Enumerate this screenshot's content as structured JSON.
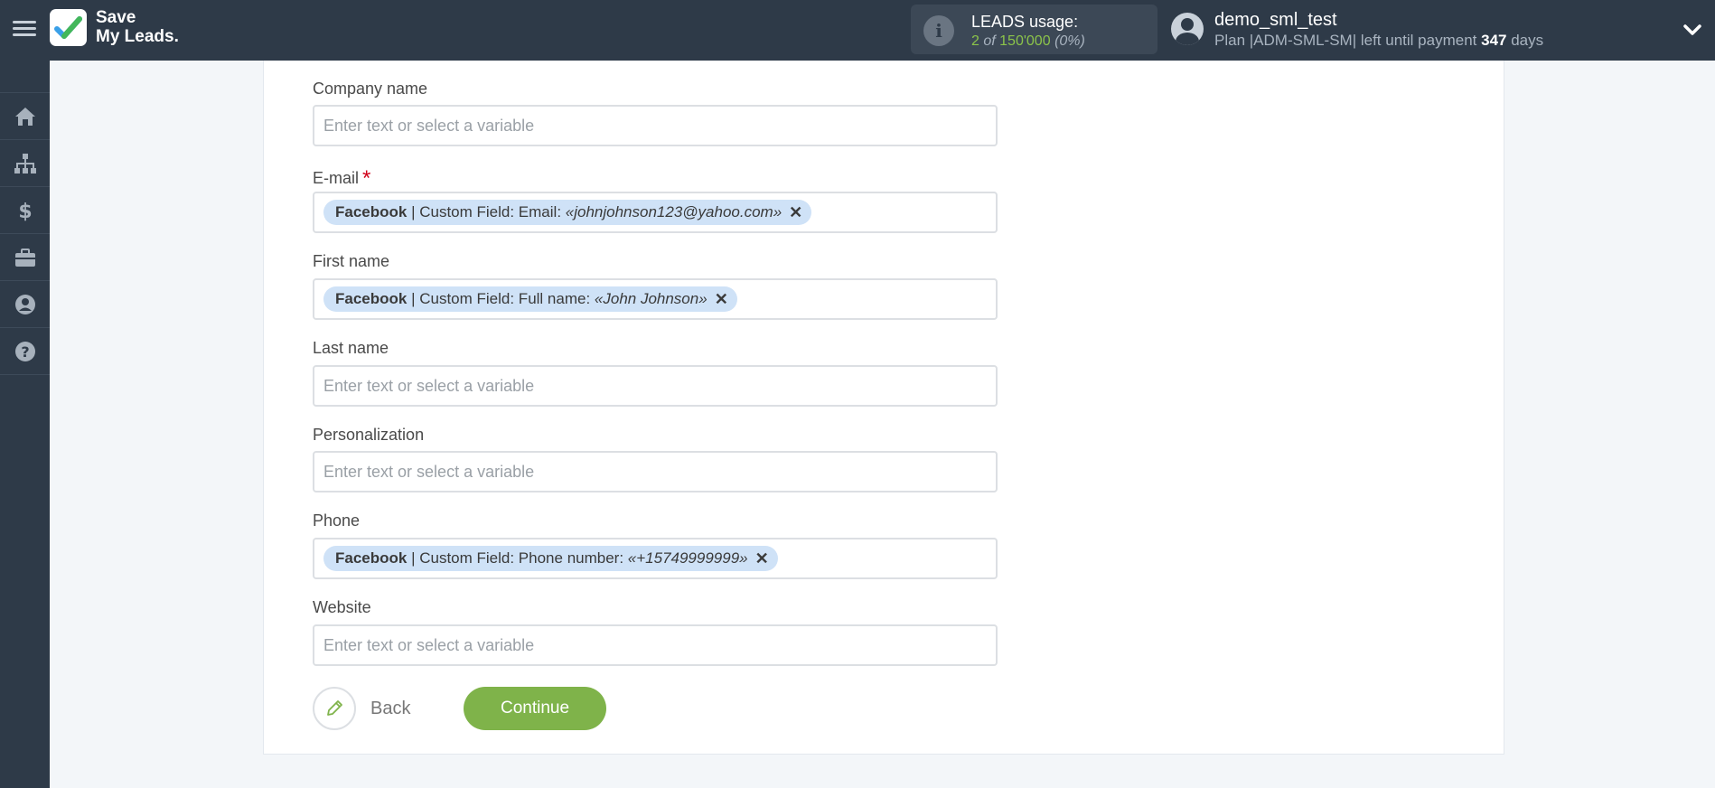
{
  "header": {
    "brand_line1": "Save",
    "brand_line2": "My Leads.",
    "usage_title": "LEADS usage:",
    "usage_used": "2",
    "usage_of": "of",
    "usage_total": "150'000",
    "usage_pct": "(0%)",
    "user_name": "demo_sml_test",
    "plan_prefix": "Plan |ADM-SML-SM| left until payment",
    "plan_days": "347",
    "plan_suffix": "days"
  },
  "colors": {
    "topbar": "#2e3a48",
    "accent_green": "#7fb34a",
    "chip_bg": "#cfe2f7",
    "required": "#d0021b"
  },
  "sidebar": {
    "items": [
      {
        "icon": "home-icon"
      },
      {
        "icon": "sitemap-icon"
      },
      {
        "icon": "dollar-icon"
      },
      {
        "icon": "briefcase-icon"
      },
      {
        "icon": "account-icon"
      },
      {
        "icon": "help-icon"
      }
    ]
  },
  "form": {
    "placeholder": "Enter text or select a variable",
    "fields": {
      "company": {
        "label": "Company name"
      },
      "email": {
        "label": "E-mail",
        "required_mark": "*",
        "chip": {
          "source": "Facebook",
          "field": " | Custom Field: Email: ",
          "value": "«johnjohnson123@yahoo.com»",
          "remove": "✕"
        }
      },
      "first_name": {
        "label": "First name",
        "chip": {
          "source": "Facebook",
          "field": " | Custom Field: Full name: ",
          "value": "«John Johnson»",
          "remove": "✕"
        }
      },
      "last_name": {
        "label": "Last name"
      },
      "personalization": {
        "label": "Personalization"
      },
      "phone": {
        "label": "Phone",
        "chip": {
          "source": "Facebook",
          "field": " | Custom Field: Phone number: ",
          "value": "«+15749999999»",
          "remove": "✕"
        }
      },
      "website": {
        "label": "Website"
      }
    }
  },
  "buttons": {
    "back": "Back",
    "continue": "Continue"
  }
}
